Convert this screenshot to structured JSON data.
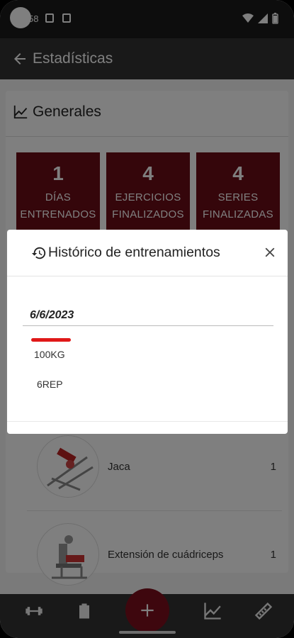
{
  "status_bar": {
    "time": "58"
  },
  "appbar": {
    "title": "Estadísticas"
  },
  "section": {
    "title": "Generales"
  },
  "stats": [
    {
      "value": "1",
      "label_line1": "DÍAS",
      "label_line2": "ENTRENADOS"
    },
    {
      "value": "4",
      "label_line1": "EJERCICIOS",
      "label_line2": "FINALIZADOS"
    },
    {
      "value": "4",
      "label_line1": "SERIES",
      "label_line2": "FINALIZADAS"
    }
  ],
  "exercises": [
    {
      "name": "Jaca",
      "count": "1"
    },
    {
      "name": "Extensión de cuádriceps",
      "count": "1"
    }
  ],
  "dialog": {
    "title": "Histórico de entrenamientos",
    "date": "6/6/2023",
    "weight": "100KG",
    "reps": "6REP"
  },
  "colors": {
    "primary": "#6b0d17",
    "fab": "#7d0f1c",
    "appbar": "#333333",
    "accent_line": "#e01818"
  },
  "icons": {
    "back": "arrow-left-icon",
    "chart": "chart-line-icon",
    "history": "history-icon",
    "close": "close-icon",
    "nav": [
      "dumbbell-icon",
      "clipboard-icon",
      "plus-icon",
      "chart-line-icon",
      "ruler-icon"
    ]
  }
}
